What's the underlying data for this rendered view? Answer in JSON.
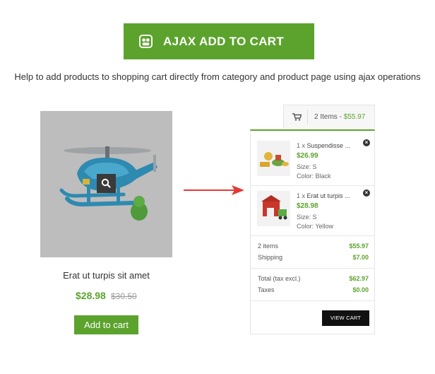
{
  "banner": {
    "title": "AJAX ADD TO CART",
    "logo_icon": "puzzle-logo-icon"
  },
  "subtitle": "Help to add products to shopping cart directly from category and product page using ajax operations",
  "product": {
    "name": "Erat ut turpis sit amet",
    "price": "$28.98",
    "old_price": "$30.50",
    "add_to_cart_label": "Add to cart",
    "quickview_icon": "search-icon"
  },
  "cart": {
    "summary_items": "2 Items - ",
    "summary_total": "$55.97",
    "cart_icon": "shopping-cart-icon",
    "items": [
      {
        "qty": "1 x",
        "name": "Suspendisse ...",
        "price": "$26.99",
        "size": "Size: S",
        "color": "Color: Black"
      },
      {
        "qty": "1 x",
        "name": "Erat ut turpis ...",
        "price": "$28.98",
        "size": "Size: S",
        "color": "Color: Yellow"
      }
    ],
    "totals": {
      "items_label": "2 items",
      "items_value": "$55.97",
      "shipping_label": "Shipping",
      "shipping_value": "$7.00",
      "total_label": "Total (tax excl.)",
      "total_value": "$62.97",
      "taxes_label": "Taxes",
      "taxes_value": "$0.00"
    },
    "view_cart_label": "VIEW CART"
  },
  "colors": {
    "accent": "#5ca32d",
    "arrow": "#e53935",
    "dark": "#111111"
  }
}
